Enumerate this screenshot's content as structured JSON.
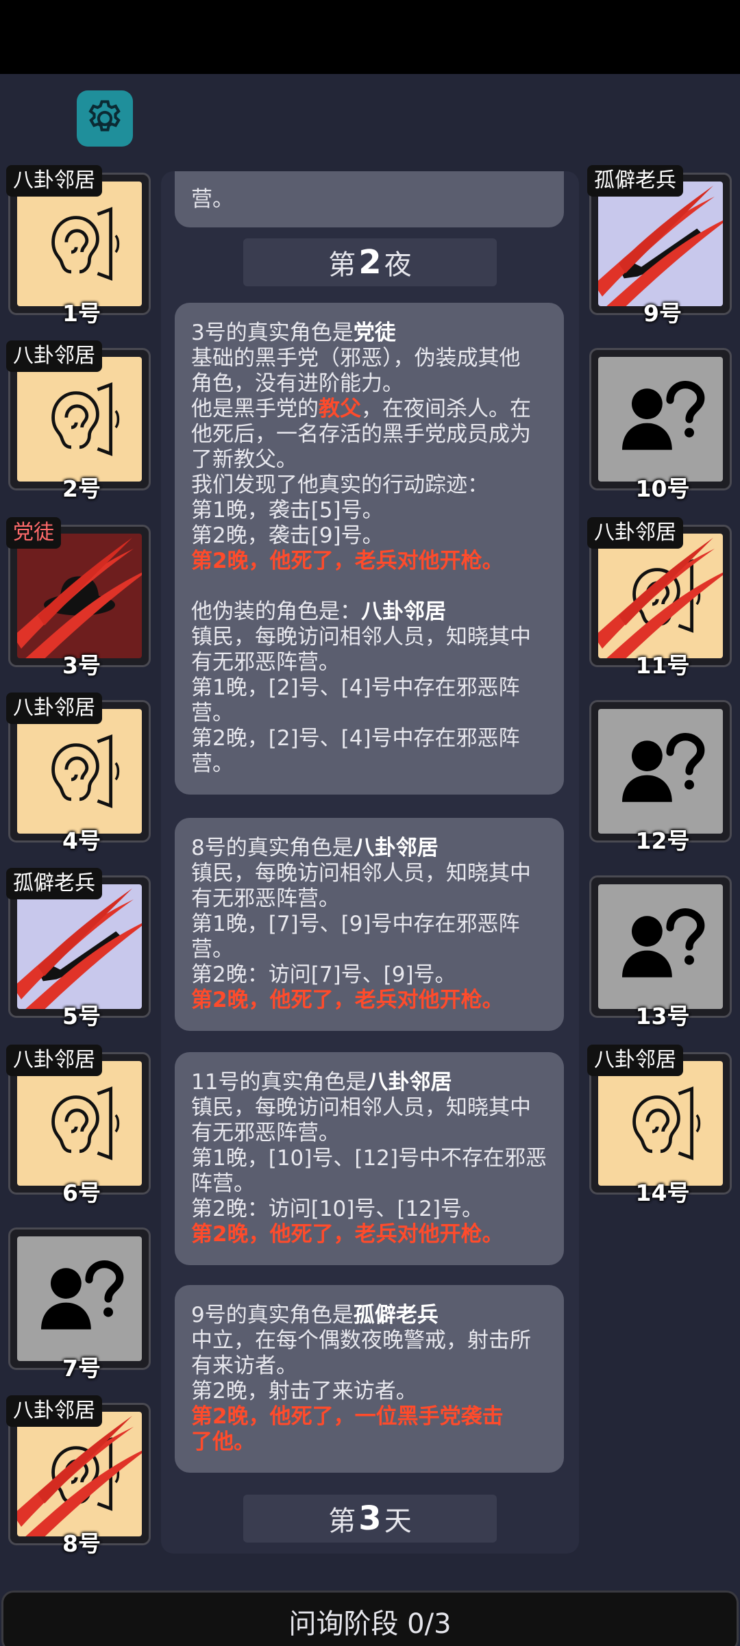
{
  "top_message_tail": "营。",
  "night2_label": {
    "prefix": "第",
    "num": "2",
    "suffix": "夜"
  },
  "day3_label": {
    "prefix": "第",
    "num": "3",
    "suffix": "天"
  },
  "msg1": {
    "l1a": "3号的真实角色是",
    "l1b": "党徒",
    "l2": "基础的黑手党（邪恶），伪装成其他",
    "l3": "角色，没有进阶能力。",
    "l4a": "他是黑手党的",
    "l4b": "教父",
    "l4c": "，在夜间杀人。在",
    "l5": "他死后，一名存活的黑手党成员成为",
    "l6": "了新教父。",
    "l7": "我们发现了他真实的行动踪迹：",
    "l8": "第1晚，袭击[5]号。",
    "l9": "第2晚，袭击[9]号。",
    "l10": "第2晚，他死了，老兵对他开枪。",
    "l11a": "他伪装的角色是：",
    "l11b": "八卦邻居",
    "l12": "镇民，每晚访问相邻人员，知晓其中",
    "l13": "有无邪恶阵营。",
    "l14": "第1晚，[2]号、[4]号中存在邪恶阵",
    "l15": "营。",
    "l16": "第2晚，[2]号、[4]号中存在邪恶阵",
    "l17": "营。"
  },
  "msg2": {
    "l1a": "8号的真实角色是",
    "l1b": "八卦邻居",
    "l2": "镇民，每晚访问相邻人员，知晓其中",
    "l3": "有无邪恶阵营。",
    "l4": "第1晚，[7]号、[9]号中存在邪恶阵",
    "l5": "营。",
    "l6": "第2晚：访问[7]号、[9]号。",
    "l7": "第2晚，他死了，老兵对他开枪。"
  },
  "msg3": {
    "l1a": "11号的真实角色是",
    "l1b": "八卦邻居",
    "l2": "镇民，每晚访问相邻人员，知晓其中",
    "l3": "有无邪恶阵营。",
    "l4": "第1晚，[10]号、[12]号中不存在邪恶",
    "l5": "阵营。",
    "l6": "第2晚：访问[10]号、[12]号。",
    "l7": "第2晚，他死了，老兵对他开枪。"
  },
  "msg4": {
    "l1a": "9号的真实角色是",
    "l1b": "孤僻老兵",
    "l2": "中立，在每个偶数夜晚警戒，射击所",
    "l3": "有来访者。",
    "l4": "第2晚，射击了来访者。",
    "l5": "第2晚，他死了，一位黑手党袭击",
    "l6": "了他。"
  },
  "players": [
    {
      "num": "1号",
      "tag": "八卦邻居"
    },
    {
      "num": "2号",
      "tag": "八卦邻居"
    },
    {
      "num": "3号",
      "tag": "党徒"
    },
    {
      "num": "4号",
      "tag": "八卦邻居"
    },
    {
      "num": "5号",
      "tag": "孤僻老兵"
    },
    {
      "num": "6号",
      "tag": "八卦邻居"
    },
    {
      "num": "7号",
      "tag": ""
    },
    {
      "num": "8号",
      "tag": "八卦邻居"
    },
    {
      "num": "9号",
      "tag": "孤僻老兵"
    },
    {
      "num": "10号",
      "tag": ""
    },
    {
      "num": "11号",
      "tag": "八卦邻居"
    },
    {
      "num": "12号",
      "tag": ""
    },
    {
      "num": "13号",
      "tag": ""
    },
    {
      "num": "14号",
      "tag": "八卦邻居"
    }
  ],
  "bottom_bar": "问询阶段 0/3",
  "icons": {
    "settings": "gear-icon",
    "neighbor": "ear-icon",
    "unknown": "unknown-person-icon",
    "veteran": "rifle-icon",
    "partisan": "hat-icon",
    "dead": "claw-slash-icon"
  },
  "colors": {
    "highlight_red": "#ff4b2b",
    "neighbor_bg": "#f8d79e",
    "veteran_bg": "#c8c8ec",
    "unknown_bg": "#a2a2a2",
    "partisan_bg": "#6e1e1e",
    "settings_bg": "#1f8f9b"
  }
}
